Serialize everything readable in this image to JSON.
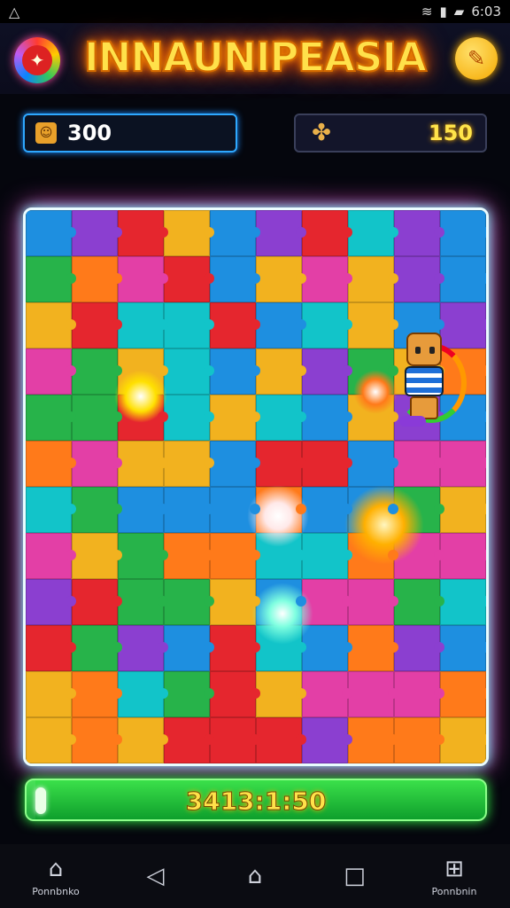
{
  "status_bar": {
    "carrier_icon": "warning-triangle-icon",
    "time": "6:03"
  },
  "header": {
    "title": "INNAUNIPEASIA",
    "left_icon": "game-logo-icon",
    "right_icon": "hint-icon"
  },
  "stats": {
    "score": "300",
    "coins": "150"
  },
  "board": {
    "columns": 10,
    "rows": 12,
    "tile_colors": [
      "#e5262e",
      "#f2b21f",
      "#27b34a",
      "#1e8fe0",
      "#8b3fd0",
      "#e33fa6",
      "#ff7a1a",
      "#12c4c9"
    ]
  },
  "timer": {
    "value": "3413:1:50",
    "progress": 0.02
  },
  "nav": {
    "items": [
      {
        "label": "Ponnbnko",
        "icon": "home-icon"
      },
      {
        "label": "",
        "icon": "back-icon"
      },
      {
        "label": "",
        "icon": "home-outline-icon"
      },
      {
        "label": "",
        "icon": "recents-icon"
      },
      {
        "label": "Ponnbnin",
        "icon": "gift-icon"
      }
    ]
  }
}
